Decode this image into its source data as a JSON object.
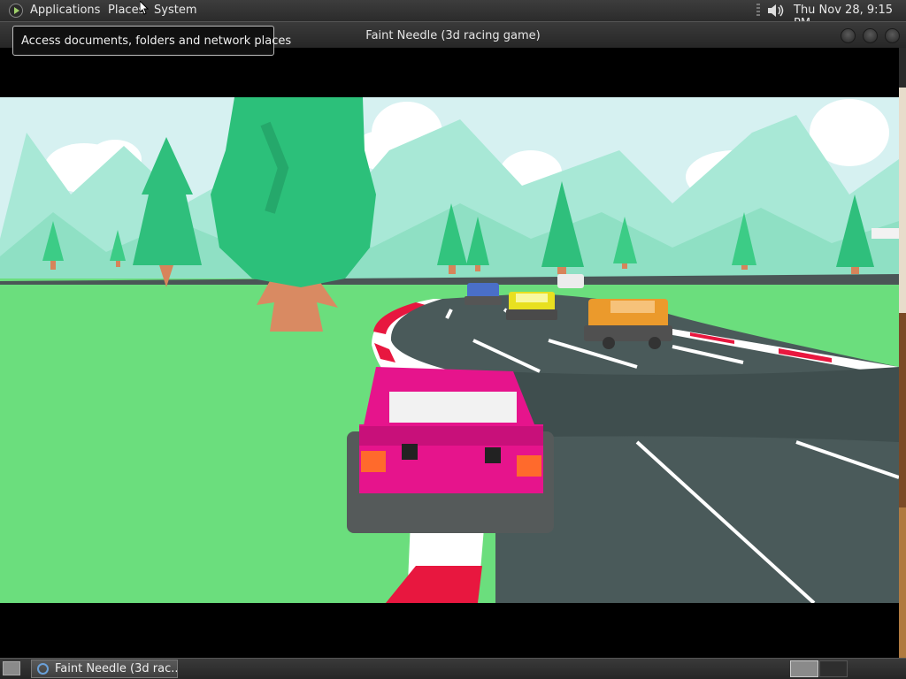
{
  "top_panel": {
    "menus": [
      "Applications",
      "Places",
      "System"
    ],
    "clock": "Thu Nov 28,  9:15 PM"
  },
  "tooltip": "Access documents, folders and network places",
  "window": {
    "title": "Faint Needle (3d racing game)"
  },
  "game": {
    "player_car_color": "#e6148c",
    "opponent_colors": [
      "#e89a2a",
      "#e8e020",
      "#4a6fc8",
      "#e8e8e8"
    ],
    "sky_color": "#d8f2f2",
    "grass_color": "#6ddf7e",
    "road_color": "#4a5a5a",
    "tree_color": "#2cc07a"
  },
  "taskbar": {
    "task_label": "Faint Needle (3d rac..."
  }
}
